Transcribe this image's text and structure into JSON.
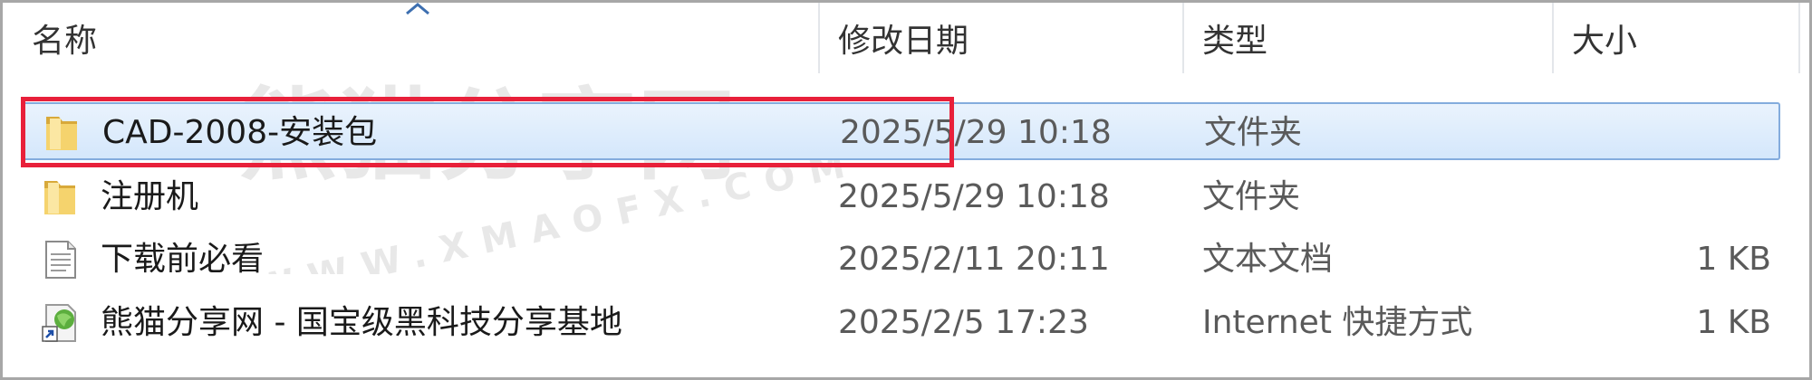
{
  "columns": {
    "name": "名称",
    "modified": "修改日期",
    "type": "类型",
    "size": "大小"
  },
  "rows": [
    {
      "name": "CAD-2008-安装包",
      "modified": "2025/5/29 10:18",
      "type": "文件夹",
      "size": "",
      "icon": "folder-icon",
      "selected": true
    },
    {
      "name": "注册机",
      "modified": "2025/5/29 10:18",
      "type": "文件夹",
      "size": "",
      "icon": "folder-icon",
      "selected": false
    },
    {
      "name": "下载前必看",
      "modified": "2025/2/11 20:11",
      "type": "文本文档",
      "size": "1 KB",
      "icon": "text-document-icon",
      "selected": false
    },
    {
      "name": "熊猫分享网 - 国宝级黑科技分享基地",
      "modified": "2025/2/5 17:23",
      "type": "Internet 快捷方式",
      "size": "1 KB",
      "icon": "internet-shortcut-icon",
      "selected": false
    }
  ],
  "watermark": {
    "text": "熊猫分享网",
    "url_text": "WWW.XMAOFX.COM"
  },
  "colors": {
    "highlight_border": "#e8203a",
    "selection_fill": "#d9e9fb",
    "selection_border": "#84acdd"
  }
}
